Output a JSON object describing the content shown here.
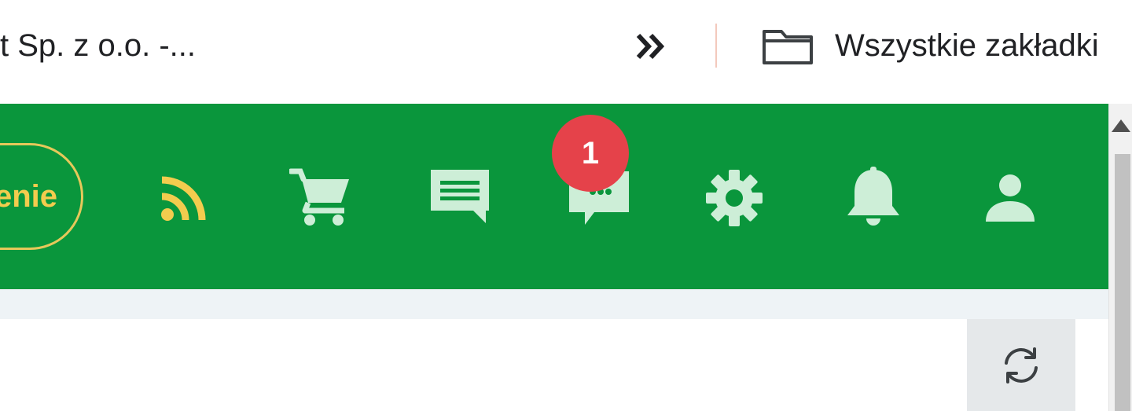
{
  "bookmarks_bar": {
    "truncated_bookmark": "t Sp. z o.o. -...",
    "overflow_icon": "double-chevron-right-icon",
    "all_bookmarks_icon": "folder-icon",
    "all_bookmarks_label": "Wszystkie zakładki"
  },
  "navbar": {
    "background_color": "#0a963c",
    "pill_label": "enie",
    "pill_color": "#f3cc4e",
    "icons": [
      {
        "name": "rss-icon",
        "color": "#f3cc4e"
      },
      {
        "name": "cart-icon",
        "color": "#cdeed7"
      },
      {
        "name": "message-icon",
        "color": "#cdeed7"
      },
      {
        "name": "chat-icon",
        "color": "#cdeed7"
      },
      {
        "name": "gear-icon",
        "color": "#cdeed7"
      },
      {
        "name": "bell-icon",
        "color": "#cdeed7"
      },
      {
        "name": "user-icon",
        "color": "#cdeed7"
      }
    ],
    "chat_badge": {
      "count": "1",
      "color": "#e5424a"
    }
  },
  "content": {
    "refresh_icon": "refresh-icon"
  }
}
